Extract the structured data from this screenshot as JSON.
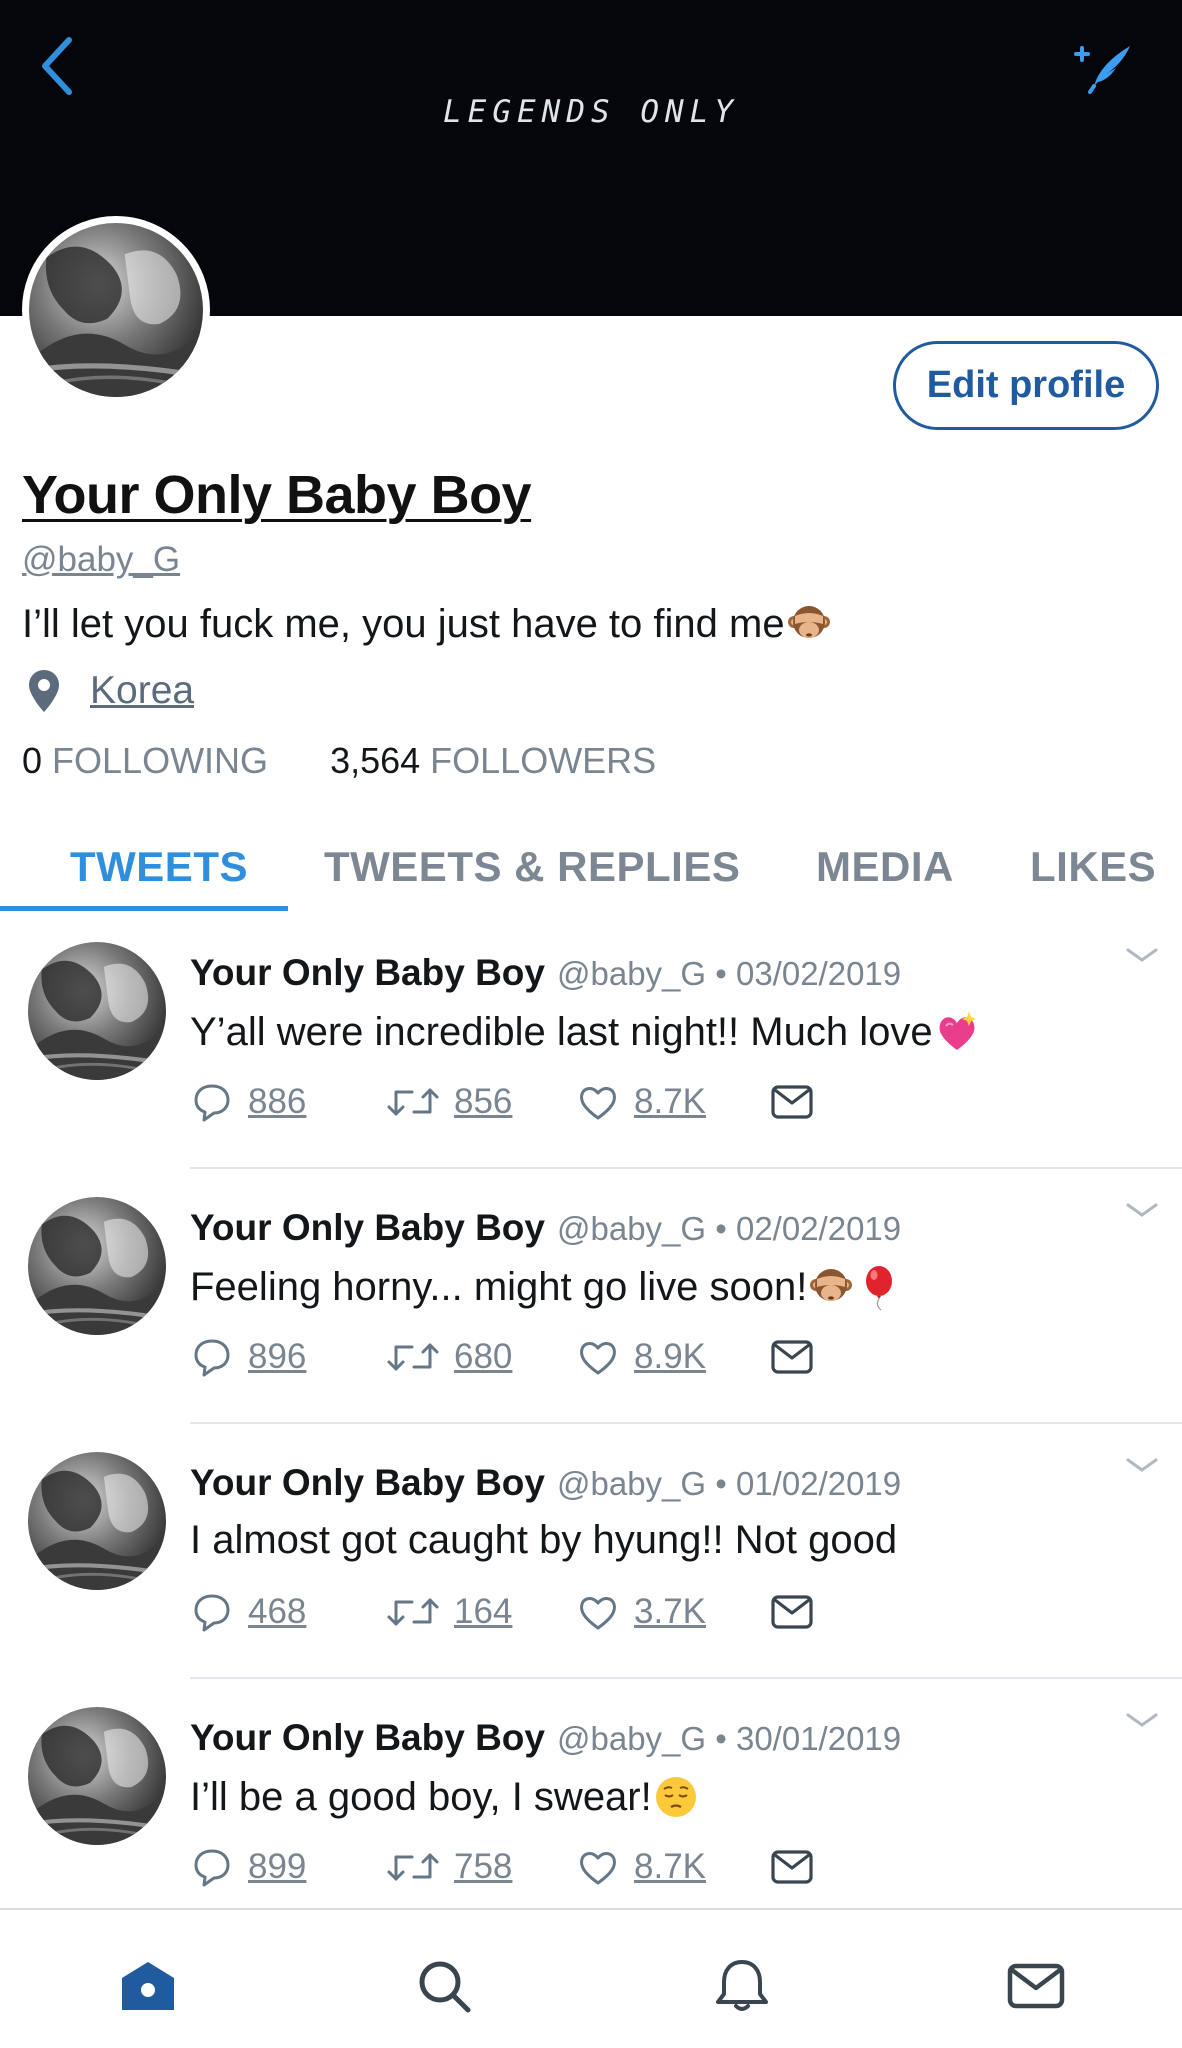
{
  "header": {
    "banner_title": "LEGENDS ONLY",
    "back_icon": "chevron-left-icon",
    "compose_icon": "compose-sparkle-icon",
    "accent_color": "#2f8fdd"
  },
  "profile": {
    "display_name": "Your Only Baby Boy",
    "handle": "@baby_G",
    "bio": "I’ll let you fuck me, you just have to find me",
    "location": "Korea",
    "following_count": "0",
    "following_label": "FOLLOWING",
    "followers_count": "3,564",
    "followers_label": "FOLLOWERS",
    "edit_button_label": "Edit profile"
  },
  "tabs": [
    {
      "label": "TWEETS",
      "active": true
    },
    {
      "label": "TWEETS & REPLIES",
      "active": false
    },
    {
      "label": "MEDIA",
      "active": false
    },
    {
      "label": "LIKES",
      "active": false
    }
  ],
  "tweets": [
    {
      "name": "Your Only Baby Boy",
      "meta": "@baby_G • 03/02/2019",
      "text": "Y’all were incredible last night!! Much love",
      "replies": "886",
      "retweets": "856",
      "likes": "8.7K"
    },
    {
      "name": "Your Only Baby Boy",
      "meta": "@baby_G • 02/02/2019",
      "text": "Feeling horny... might go live soon!",
      "replies": "896",
      "retweets": "680",
      "likes": "8.9K"
    },
    {
      "name": "Your Only Baby Boy",
      "meta": "@baby_G • 01/02/2019",
      "text": "I almost got caught by hyung!! Not good",
      "replies": "468",
      "retweets": "164",
      "likes": "3.7K"
    },
    {
      "name": "Your Only Baby Boy",
      "meta": "@baby_G • 30/01/2019",
      "text": "I’ll be a good boy, I swear!",
      "replies": "899",
      "retweets": "758",
      "likes": "8.7K"
    }
  ],
  "bottom_nav": [
    "home-icon",
    "search-icon",
    "notifications-bell-icon",
    "messages-envelope-icon"
  ]
}
